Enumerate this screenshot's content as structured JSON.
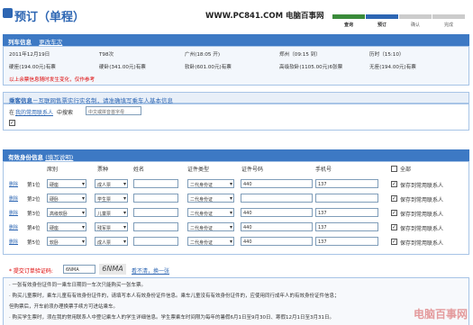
{
  "header": {
    "title": "预订（单程）",
    "site": "WWW.PC841.COM 电脑百事网",
    "steps": [
      "查询",
      "预订",
      "确认",
      "完成"
    ]
  },
  "train": {
    "section_title": "列车信息",
    "change_link": "更改车次",
    "date": "2011年12月19日",
    "train_no": "T98次",
    "from": "广州(18:05 开)",
    "to": "郑州（09:15 到）",
    "duration": "历时（15:10）",
    "prices": [
      "硬座(194.00元)有票",
      "硬卧(341.00元)有票",
      "软卧(601.00元)有票",
      "高级软卧(1105.00元)6张票",
      "无座(194.00元)有票"
    ],
    "note": "以上余票信息随时发生变化，仅作参考"
  },
  "passenger_info": {
    "section_title": "乘客信息",
    "section_desc": "－互联网售票实行实名制，请准确填写乘车人基本信息",
    "search_prefix": "在",
    "search_link": "我的常用联系人",
    "search_suffix": "中搜索",
    "search_placeholder": "中文或拼音首字母"
  },
  "id_info": {
    "section_title": "有效身份信息",
    "fill_link": "(填写说明)",
    "columns": [
      "席别",
      "票种",
      "姓名",
      "证件类型",
      "证件号码",
      "手机号",
      "全部"
    ],
    "delete_label": "删除",
    "save_label": "保存到常用联系人",
    "rows": [
      {
        "seat": "第1位",
        "class": "硬座",
        "ticket": "成人票",
        "id_type": "二代身份证",
        "id_no": "440",
        "phone": "137"
      },
      {
        "seat": "第2位",
        "class": "硬卧",
        "ticket": "学生票",
        "id_type": "二代身份证",
        "id_no": "",
        "phone": ""
      },
      {
        "seat": "第3位",
        "class": "高级软卧",
        "ticket": "儿童票",
        "id_type": "二代身份证",
        "id_no": "440",
        "phone": "137"
      },
      {
        "seat": "第4位",
        "class": "硬座",
        "ticket": "残军票",
        "id_type": "二代身份证",
        "id_no": "440",
        "phone": "137"
      },
      {
        "seat": "第5位",
        "class": "软卧",
        "ticket": "成人票",
        "id_type": "二代身份证",
        "id_no": "440",
        "phone": "137"
      }
    ]
  },
  "captcha": {
    "label": "* 提交订单验证码:",
    "value": "6NMA",
    "image_text": "6NMA",
    "refresh": "看不清，换一张"
  },
  "notes": [
    "· 一张有效身份证件同一乘车日期同一车次只能购买一张车票。",
    "· 购买儿童票时，乘车儿童有有效身份证件的，请填写本人有效身份证件信息。乘车儿童没有有效身份证件的，应使用同行成年人的有效身份证件信息；",
    "  但购票后，开车前须办理换票手续方可进站乘车。",
    "· 购买学生票时，须在我的常用联系人中登记乘车人的学生详细信息。学生票乘车时间限为每年的暑假6月1日至9月30日、寒假12月1日至3月31日。"
  ],
  "watermark": "电脑百事网"
}
